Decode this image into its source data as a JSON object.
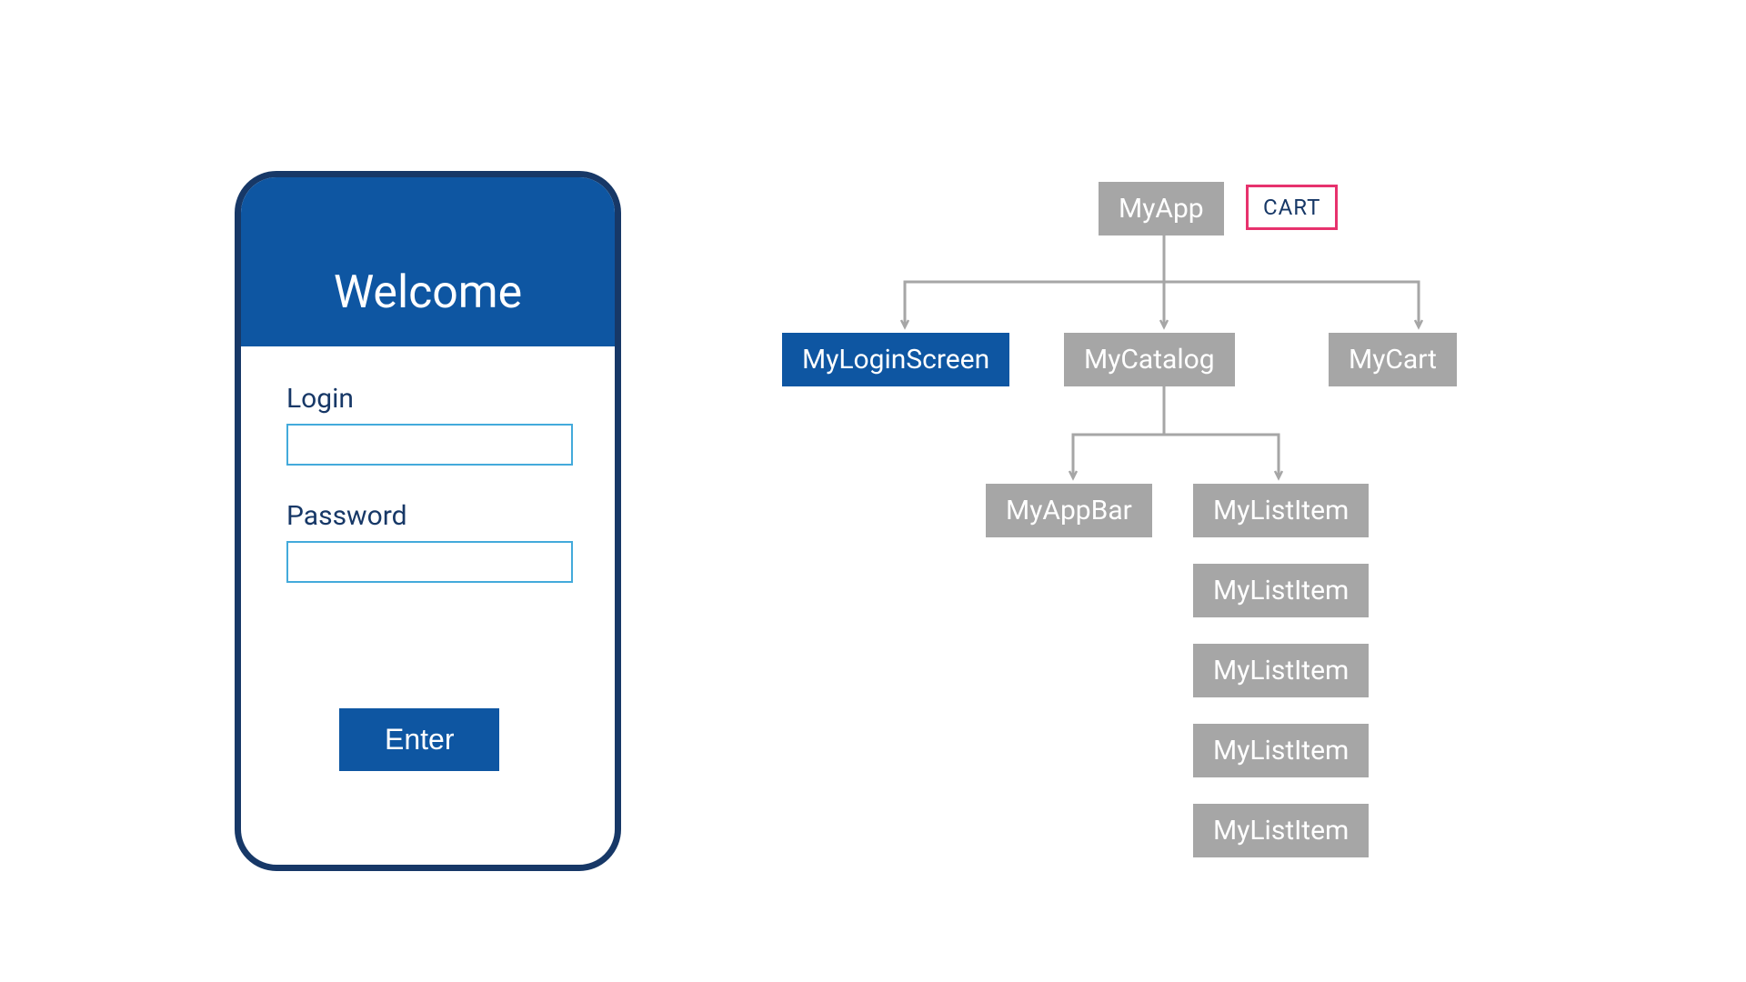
{
  "phone": {
    "title": "Welcome",
    "login_label": "Login",
    "password_label": "Password",
    "enter_button": "Enter"
  },
  "tree": {
    "root": "MyApp",
    "cart_badge": "CART",
    "children": {
      "login": "MyLoginScreen",
      "catalog": "MyCatalog",
      "cart": "MyCart"
    },
    "catalog_children": {
      "appbar": "MyAppBar",
      "list_items": [
        "MyListItem",
        "MyListItem",
        "MyListItem",
        "MyListItem",
        "MyListItem"
      ]
    }
  },
  "colors": {
    "primary_blue": "#0e56a2",
    "dark_navy": "#173867",
    "node_gray": "#a6a6a6",
    "input_border": "#43aadb",
    "badge_border": "#e7326d"
  }
}
